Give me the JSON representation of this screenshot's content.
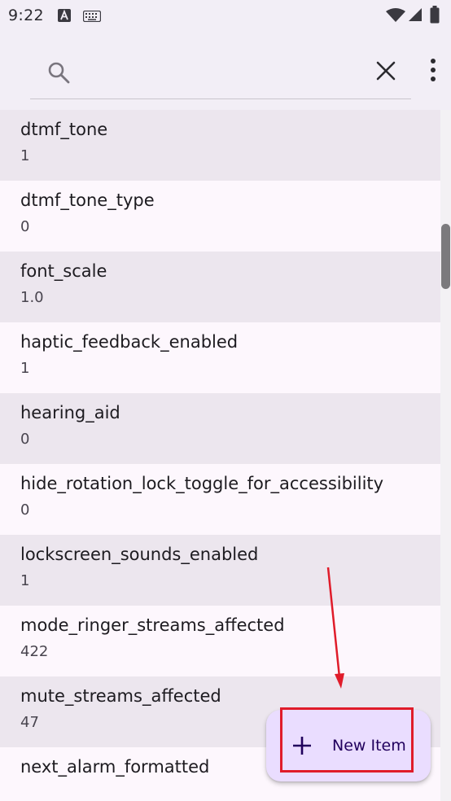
{
  "status_bar": {
    "time": "9:22",
    "icons": [
      "a-notification-icon",
      "keyboard-icon",
      "wifi-icon",
      "signal-icon",
      "battery-icon"
    ]
  },
  "search": {
    "value": "",
    "placeholder": "",
    "icons": [
      "search-icon",
      "close-icon",
      "more-vert-icon"
    ]
  },
  "list": {
    "items": [
      {
        "key": "dtmf_tone",
        "value": "1"
      },
      {
        "key": "dtmf_tone_type",
        "value": "0"
      },
      {
        "key": "font_scale",
        "value": "1.0"
      },
      {
        "key": "haptic_feedback_enabled",
        "value": "1"
      },
      {
        "key": "hearing_aid",
        "value": "0"
      },
      {
        "key": "hide_rotation_lock_toggle_for_accessibility",
        "value": "0"
      },
      {
        "key": "lockscreen_sounds_enabled",
        "value": "1"
      },
      {
        "key": "mode_ringer_streams_affected",
        "value": "422"
      },
      {
        "key": "mute_streams_affected",
        "value": "47"
      },
      {
        "key": "next_alarm_formatted",
        "value": ""
      }
    ]
  },
  "fab": {
    "label": "New Item",
    "icon": "plus-icon"
  },
  "colors": {
    "surface": "#fdf7fd",
    "surface_alt": "#ece6ee",
    "header": "#f2eef6",
    "fab": "#eaddff",
    "fab_text": "#21005d",
    "annotation": "#e01c2a"
  }
}
